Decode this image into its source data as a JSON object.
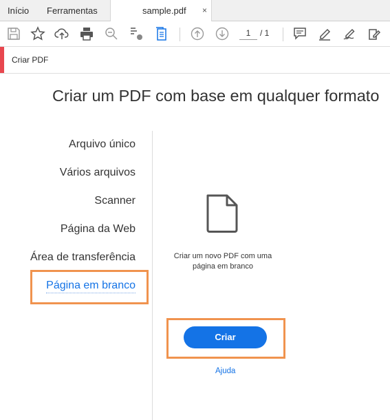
{
  "tabs": {
    "home": "Início",
    "tools": "Ferramentas",
    "document": "sample.pdf",
    "close": "×"
  },
  "toolbar": {
    "page_current": "1",
    "page_total": "/ 1"
  },
  "header": {
    "title": "Criar PDF"
  },
  "main": {
    "title": "Criar um PDF com base em qualquer formato",
    "options": [
      "Arquivo único",
      "Vários arquivos",
      "Scanner",
      "Página da Web",
      "Área de transferência",
      "Página em branco"
    ],
    "selected_option": "Página em branco",
    "description": "Criar um novo PDF com uma página em branco",
    "create_label": "Criar",
    "help_label": "Ajuda"
  },
  "colors": {
    "accent": "#1473e6",
    "brand_red": "#e8474f",
    "highlight": "#f0934e"
  }
}
